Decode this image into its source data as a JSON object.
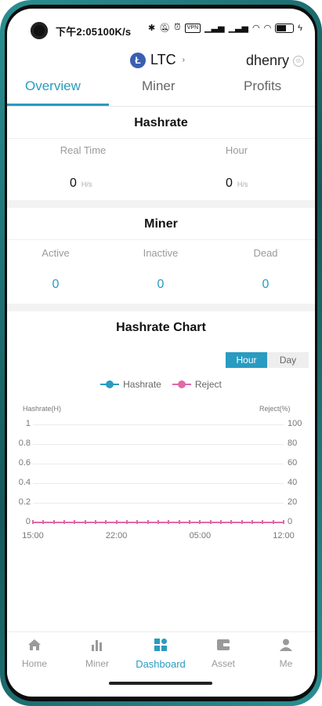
{
  "status_bar": {
    "time": "下午2:05",
    "network_speed": "100K/s",
    "icons": [
      "bluetooth-icon",
      "mute-icon",
      "alarm-icon",
      "vpn-icon",
      "signal-icon",
      "signal-icon",
      "wifi-icon",
      "wifi-icon",
      "battery-icon",
      "charging-icon"
    ],
    "vpn_label": "VPN"
  },
  "topbar": {
    "coin_logo_letter": "Ł",
    "coin": "LTC",
    "coin_caret": "›",
    "username": "dhenry",
    "user_icon": "⊝"
  },
  "tabs": [
    {
      "label": "Overview",
      "active": true
    },
    {
      "label": "Miner",
      "active": false
    },
    {
      "label": "Profits",
      "active": false
    }
  ],
  "hashrate_card": {
    "title": "Hashrate",
    "realtime_label": "Real Time",
    "realtime_value": "0",
    "realtime_unit": "H/s",
    "hour_label": "Hour",
    "hour_value": "0",
    "hour_unit": "H/s"
  },
  "miner_card": {
    "title": "Miner",
    "active_label": "Active",
    "active_value": "0",
    "inactive_label": "Inactive",
    "inactive_value": "0",
    "dead_label": "Dead",
    "dead_value": "0"
  },
  "chart_card": {
    "title": "Hashrate Chart",
    "toggle": {
      "hour_label": "Hour",
      "day_label": "Day",
      "selected": "Hour"
    }
  },
  "chart_data": {
    "type": "line",
    "title": "Hashrate Chart",
    "x": [
      "15:00",
      "22:00",
      "05:00",
      "12:00"
    ],
    "y_left": {
      "label": "Hashrate(H)",
      "ticks": [
        "1",
        "0.8",
        "0.6",
        "0.4",
        "0.2",
        "0"
      ],
      "ylim": [
        0,
        1
      ]
    },
    "y_right": {
      "label": "Reject(%)",
      "ticks": [
        "100",
        "80",
        "60",
        "40",
        "20",
        "0"
      ],
      "ylim": [
        0,
        100
      ]
    },
    "series": [
      {
        "name": "Hashrate",
        "color": "#2a9bc1",
        "values": [
          0,
          0,
          0,
          0
        ]
      },
      {
        "name": "Reject",
        "color": "#e06aa8",
        "values": [
          0,
          0,
          0,
          0
        ]
      }
    ],
    "legend_position": "top-center",
    "grid": true
  },
  "bottom_nav": [
    {
      "label": "Home",
      "icon": "home-icon",
      "active": false
    },
    {
      "label": "Miner",
      "icon": "bar-chart-icon",
      "active": false
    },
    {
      "label": "Dashboard",
      "icon": "dashboard-icon",
      "active": true
    },
    {
      "label": "Asset",
      "icon": "wallet-icon",
      "active": false
    },
    {
      "label": "Me",
      "icon": "person-icon",
      "active": false
    }
  ],
  "colors": {
    "accent": "#2a9bc1",
    "reject": "#e06aa8",
    "frame": "#2a8f92"
  }
}
